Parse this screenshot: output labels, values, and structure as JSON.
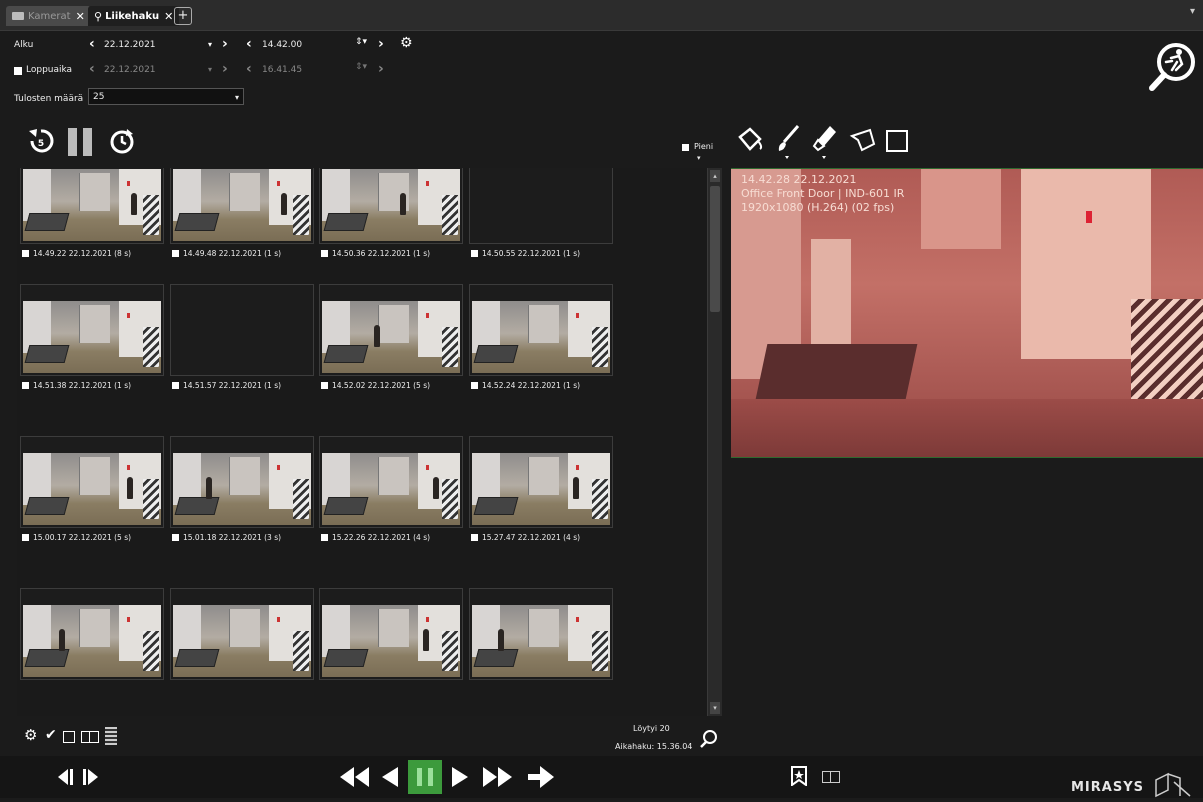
{
  "tabs": [
    {
      "label": "Kamerat",
      "icon": "camera-icon",
      "active": false
    },
    {
      "label": "Liikehaku",
      "icon": "motion-search-icon",
      "active": true
    }
  ],
  "filters": {
    "start_label": "Alku",
    "start_date": "22.12.2021",
    "start_time": "14.42.00",
    "end_label": "Loppuaika",
    "end_date": "22.12.2021",
    "end_time": "16.41.45",
    "result_count_label": "Tulosten määrä",
    "result_count_value": "25"
  },
  "view_toggle_label": "Pieni",
  "results": [
    {
      "caption": "14.49.22  22.12.2021 (8 s)",
      "has_image": true,
      "person": 0.83
    },
    {
      "caption": "14.49.48  22.12.2021 (1 s)",
      "has_image": true,
      "person": 0.83
    },
    {
      "caption": "14.50.36  22.12.2021 (1 s)",
      "has_image": true,
      "person": 0.6
    },
    {
      "caption": "14.50.55  22.12.2021 (1 s)",
      "has_image": false,
      "person": null
    },
    {
      "caption": "14.51.38  22.12.2021 (1 s)",
      "has_image": true,
      "person": null
    },
    {
      "caption": "14.51.57  22.12.2021 (1 s)",
      "has_image": false,
      "person": null
    },
    {
      "caption": "14.52.02  22.12.2021 (5 s)",
      "has_image": true,
      "person": 0.4
    },
    {
      "caption": "14.52.24  22.12.2021 (1 s)",
      "has_image": true,
      "person": null
    },
    {
      "caption": "15.00.17  22.12.2021 (5 s)",
      "has_image": true,
      "person": 0.8
    },
    {
      "caption": "15.01.18  22.12.2021 (3 s)",
      "has_image": true,
      "person": 0.25
    },
    {
      "caption": "15.22.26  22.12.2021 (4 s)",
      "has_image": true,
      "person": 0.85
    },
    {
      "caption": "15.27.47  22.12.2021 (4 s)",
      "has_image": true,
      "person": 0.78
    },
    {
      "caption": "",
      "has_image": true,
      "person": 0.28
    },
    {
      "caption": "",
      "has_image": true,
      "person": null
    },
    {
      "caption": "",
      "has_image": true,
      "person": 0.78
    },
    {
      "caption": "",
      "has_image": true,
      "person": 0.2
    }
  ],
  "preview": {
    "timestamp": "14.42.28  22.12.2021",
    "camera": "Office Front Door | IND-601 IR",
    "resolution": "1920x1080 (H.264) (02 fps)"
  },
  "status": {
    "found": "Löytyi 20",
    "search_time": "Aikahaku: 15.36.04"
  },
  "brand": "MIRASYS",
  "colors": {
    "accent_green": "#3c9a3c",
    "background": "#1b1b1b"
  }
}
